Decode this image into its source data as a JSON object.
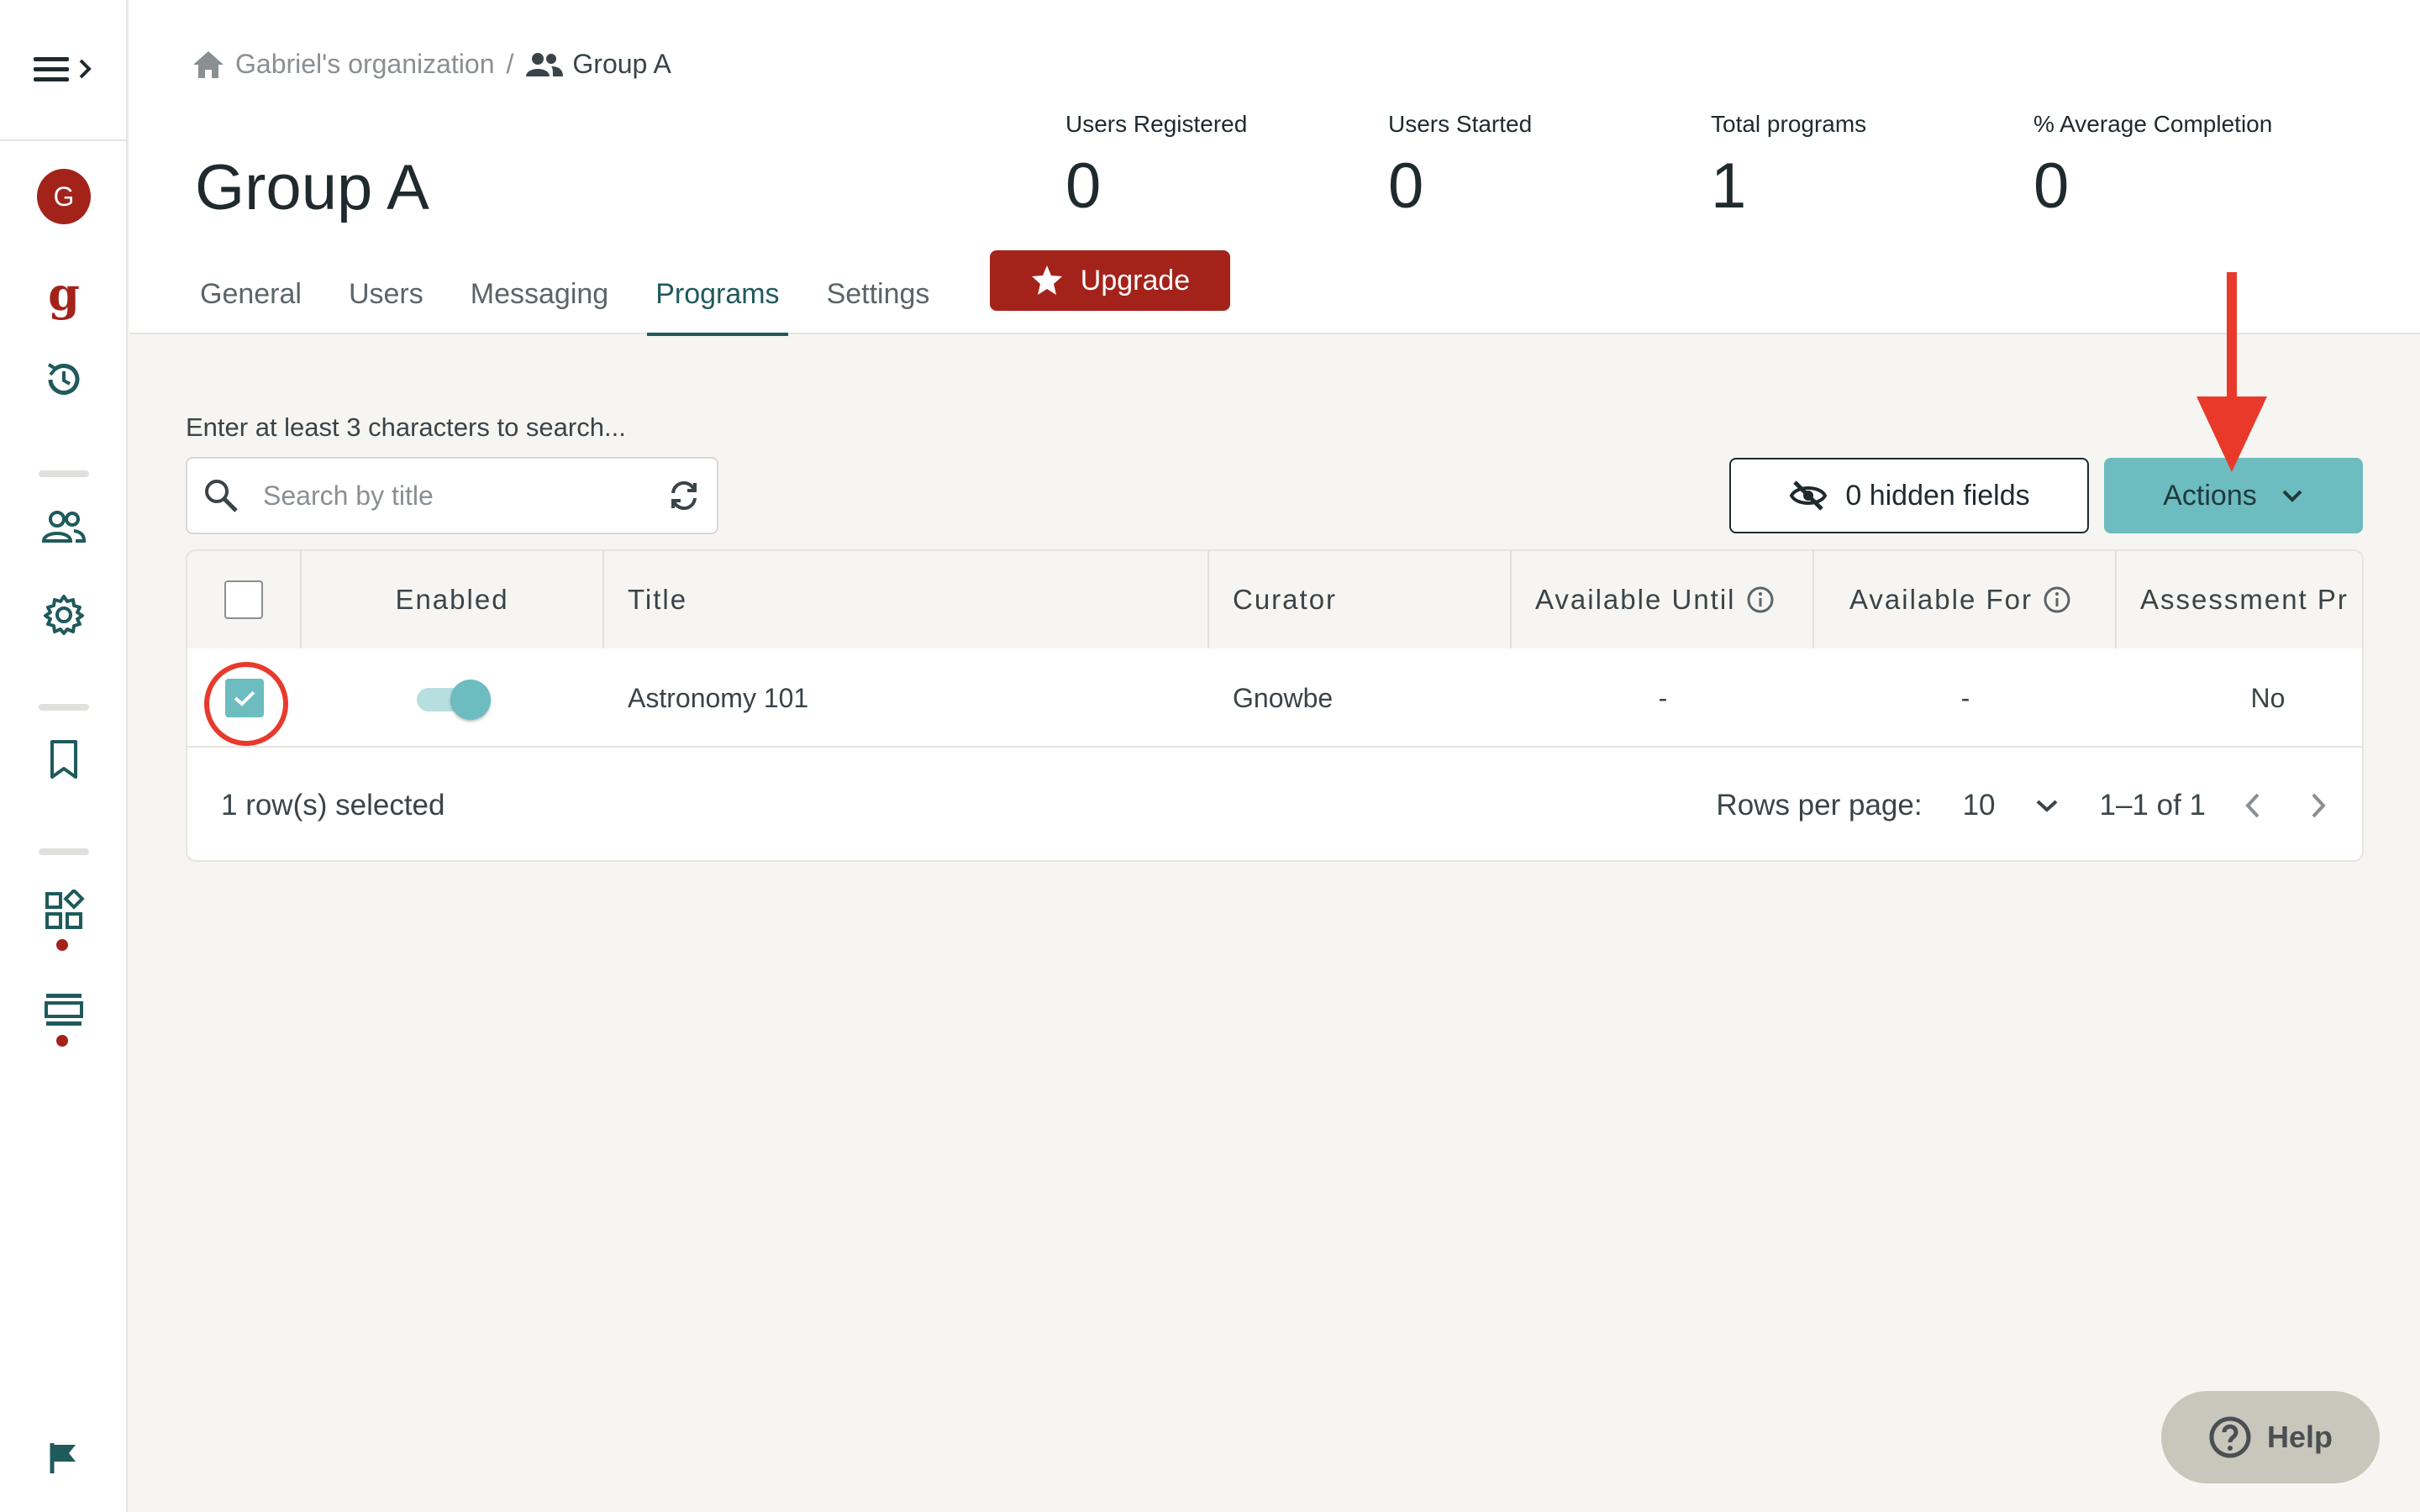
{
  "breadcrumb": {
    "org": "Gabriel's organization",
    "separator": "/",
    "group": "Group A"
  },
  "page": {
    "title": "Group A"
  },
  "stats": [
    {
      "label": "Users Registered",
      "value": "0"
    },
    {
      "label": "Users Started",
      "value": "0"
    },
    {
      "label": "Total programs",
      "value": "1"
    },
    {
      "label": "% Average Completion",
      "value": "0"
    }
  ],
  "tabs": [
    {
      "label": "General"
    },
    {
      "label": "Users"
    },
    {
      "label": "Messaging"
    },
    {
      "label": "Programs",
      "active": true
    },
    {
      "label": "Settings"
    }
  ],
  "upgrade_label": "Upgrade",
  "sidebar": {
    "avatar_letter": "G",
    "brand_letter": "g"
  },
  "search": {
    "hint": "Enter at least 3 characters to search...",
    "placeholder": "Search by title"
  },
  "toolbar": {
    "hidden_fields_label": "0 hidden fields",
    "actions_label": "Actions"
  },
  "table": {
    "columns": [
      "Enabled",
      "Title",
      "Curator",
      "Available Until",
      "Available For",
      "Assessment Pr"
    ],
    "rows": [
      {
        "selected": true,
        "enabled": true,
        "title": "Astronomy 101",
        "curator": "Gnowbe",
        "available_until": "-",
        "available_for": "-",
        "assessment": "No"
      }
    ],
    "footer": {
      "selected_text": "1 row(s) selected",
      "rows_per_page_label": "Rows per page:",
      "rows_per_page_value": "10",
      "range_text": "1–1 of 1"
    }
  },
  "help_label": "Help",
  "colors": {
    "brand_red": "#a3231b",
    "teal": "#6cbcc0",
    "annotation_red": "#e8392b"
  }
}
